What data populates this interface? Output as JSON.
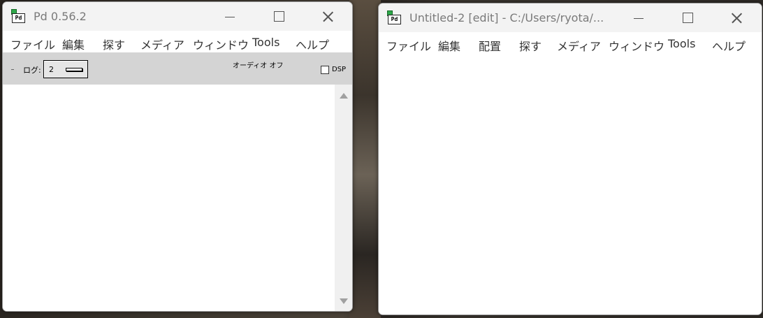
{
  "main_window": {
    "title": "Pd 0.56.2",
    "icon_text": "Pd",
    "menu": [
      "ファイル",
      "編集",
      "探す",
      "メディア",
      "ウィンドウ",
      "Tools",
      "ヘルプ"
    ],
    "toolbar": {
      "log_label": "ログ:",
      "log_value": "2",
      "audio_status": "オーディオ オフ",
      "dsp_label": "DSP",
      "dsp_checked": false
    }
  },
  "patch_window": {
    "title": "Untitled-2  [edit] - C:/Users/ryota/...",
    "icon_text": "Pd",
    "menu": [
      "ファイル",
      "編集",
      "配置",
      "探す",
      "メディア",
      "ウィンドウ",
      "Tools",
      "ヘルプ"
    ]
  },
  "icons": [
    "pd-app-icon",
    "minimize-icon",
    "maximize-icon",
    "close-icon",
    "scroll-up-arrow-icon",
    "scroll-down-arrow-icon"
  ],
  "colors": {
    "titlebar": "#f3f3f3",
    "toolbar": "#d4d4d4",
    "icon_green": "#2ea84a",
    "title_text": "#7a7a7a"
  }
}
